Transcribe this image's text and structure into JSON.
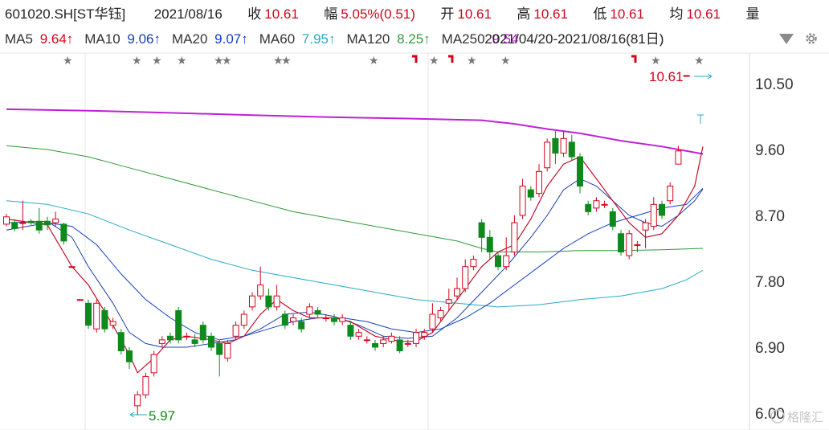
{
  "header": {
    "code": "601020.SH[ST华钰]",
    "date": "2021/08/16",
    "close_label": "收",
    "close": "10.61",
    "change_label": "幅",
    "change": "5.05%(0.51)",
    "open_label": "开",
    "open": "10.61",
    "high_label": "高",
    "high": "10.61",
    "low_label": "低",
    "low": "10.61",
    "avg_label": "均",
    "avg": "10.61",
    "vol_label": "量"
  },
  "ma_legend": [
    {
      "name": "MA5",
      "value": "9.64",
      "arrow": "↑",
      "color": "#d2041c"
    },
    {
      "name": "MA10",
      "value": "9.06",
      "arrow": "↑",
      "color": "#1c3fa8"
    },
    {
      "name": "MA20",
      "value": "9.07",
      "arrow": "↑",
      "color": "#1040c8"
    },
    {
      "name": "MA60",
      "value": "7.95",
      "arrow": "↑",
      "color": "#27aac6"
    },
    {
      "name": "MA120",
      "value": "8.25",
      "arrow": "↑",
      "color": "#2e9a3b"
    },
    {
      "name": "MA250",
      "value": "9.54",
      "arrow": "",
      "color": "#c020d8"
    }
  ],
  "range_text": "2021/04/20-2021/08/16(81日)",
  "icons": {
    "collapse": "triangle-down-icon",
    "settings": "gear-icon"
  },
  "colors": {
    "up": "#d2041c",
    "down": "#0e8a1c",
    "grid": "#e4e4e4",
    "axis_text": "#333333"
  },
  "watermark": "格隆汇",
  "chart_data": {
    "type": "candlestick",
    "ylim": [
      6.0,
      10.7
    ],
    "y_ticks": [
      "10.50",
      "9.60",
      "8.70",
      "7.80",
      "6.90",
      "6.00"
    ],
    "y_tick_values": [
      10.5,
      9.6,
      8.7,
      7.8,
      6.9,
      6.0
    ],
    "annotations": {
      "max_label": "10.61",
      "min_label": "5.97",
      "min_index": 15
    },
    "candles": [
      [
        8.58,
        8.68,
        8.55,
        8.72
      ],
      [
        8.6,
        8.52,
        8.48,
        8.65
      ],
      [
        8.6,
        8.6,
        8.5,
        8.9
      ],
      [
        8.62,
        8.6,
        8.57,
        8.65
      ],
      [
        8.62,
        8.5,
        8.45,
        8.8
      ],
      [
        8.62,
        8.57,
        8.5,
        8.68
      ],
      [
        8.6,
        8.65,
        8.55,
        8.75
      ],
      [
        8.58,
        8.35,
        8.3,
        8.6
      ],
      [
        8.0,
        8.0,
        8.0,
        8.0
      ],
      [
        7.55,
        7.55,
        7.55,
        7.55
      ],
      [
        7.5,
        7.2,
        7.15,
        7.55
      ],
      [
        7.15,
        7.5,
        7.1,
        7.55
      ],
      [
        7.4,
        7.15,
        7.1,
        7.45
      ],
      [
        7.2,
        7.25,
        7.15,
        7.3
      ],
      [
        7.1,
        6.85,
        6.8,
        7.15
      ],
      [
        6.85,
        6.7,
        6.6,
        6.9
      ],
      [
        6.1,
        6.25,
        5.97,
        6.3
      ],
      [
        6.25,
        6.5,
        6.2,
        6.55
      ],
      [
        6.55,
        6.8,
        6.5,
        6.85
      ],
      [
        6.95,
        7.0,
        6.9,
        7.05
      ],
      [
        7.05,
        7.0,
        6.95,
        7.1
      ],
      [
        7.4,
        7.0,
        6.95,
        7.45
      ],
      [
        7.05,
        7.05,
        7.0,
        7.1
      ],
      [
        7.0,
        6.95,
        6.9,
        7.08
      ],
      [
        7.2,
        7.0,
        6.95,
        7.25
      ],
      [
        7.05,
        6.9,
        6.85,
        7.1
      ],
      [
        6.95,
        6.8,
        6.5,
        7.0
      ],
      [
        6.75,
        6.95,
        6.7,
        7.0
      ],
      [
        7.05,
        7.2,
        7.0,
        7.25
      ],
      [
        7.2,
        7.35,
        7.15,
        7.4
      ],
      [
        7.45,
        7.6,
        7.4,
        7.65
      ],
      [
        7.6,
        7.75,
        7.55,
        8.0
      ],
      [
        7.6,
        7.45,
        7.4,
        7.7
      ],
      [
        7.45,
        7.6,
        7.4,
        7.75
      ],
      [
        7.35,
        7.2,
        7.15,
        7.4
      ],
      [
        7.25,
        7.3,
        7.2,
        7.35
      ],
      [
        7.25,
        7.15,
        7.1,
        7.3
      ],
      [
        7.35,
        7.45,
        7.3,
        7.5
      ],
      [
        7.4,
        7.35,
        7.3,
        7.45
      ],
      [
        7.3,
        7.3,
        7.25,
        7.35
      ],
      [
        7.3,
        7.25,
        7.2,
        7.35
      ],
      [
        7.25,
        7.3,
        7.2,
        7.35
      ],
      [
        7.2,
        7.05,
        7.0,
        7.25
      ],
      [
        7.05,
        7.1,
        7.0,
        7.15
      ],
      [
        7.0,
        7.0,
        6.95,
        7.05
      ],
      [
        6.95,
        6.9,
        6.85,
        7.0
      ],
      [
        6.95,
        7.0,
        6.9,
        7.05
      ],
      [
        6.98,
        7.05,
        6.95,
        7.1
      ],
      [
        7.0,
        6.85,
        6.82,
        7.05
      ],
      [
        6.95,
        6.95,
        6.9,
        7.0
      ],
      [
        6.95,
        7.1,
        6.9,
        7.15
      ],
      [
        7.05,
        7.1,
        7.0,
        7.15
      ],
      [
        7.15,
        7.35,
        7.1,
        7.5
      ],
      [
        7.3,
        7.4,
        7.25,
        7.45
      ],
      [
        7.5,
        7.55,
        7.4,
        7.7
      ],
      [
        7.6,
        7.7,
        7.55,
        7.85
      ],
      [
        7.7,
        8.0,
        7.65,
        8.1
      ],
      [
        8.0,
        8.1,
        7.95,
        8.15
      ],
      [
        8.6,
        8.4,
        8.2,
        8.65
      ],
      [
        8.4,
        8.2,
        8.1,
        8.5
      ],
      [
        8.15,
        8.0,
        7.95,
        8.2
      ],
      [
        8.0,
        8.15,
        7.95,
        8.4
      ],
      [
        8.2,
        8.6,
        8.15,
        8.7
      ],
      [
        8.7,
        9.1,
        8.65,
        9.2
      ],
      [
        9.05,
        8.95,
        8.9,
        9.1
      ],
      [
        9.0,
        9.3,
        8.95,
        9.4
      ],
      [
        9.35,
        9.7,
        9.3,
        9.75
      ],
      [
        9.75,
        9.55,
        9.4,
        9.85
      ],
      [
        9.55,
        9.75,
        9.5,
        9.85
      ],
      [
        9.7,
        9.5,
        9.45,
        9.8
      ],
      [
        9.5,
        9.1,
        9.0,
        9.55
      ],
      [
        8.85,
        8.75,
        8.7,
        8.9
      ],
      [
        8.8,
        8.9,
        8.75,
        8.95
      ],
      [
        8.85,
        8.85,
        8.8,
        8.9
      ],
      [
        8.75,
        8.55,
        8.5,
        8.8
      ],
      [
        8.45,
        8.2,
        8.15,
        8.5
      ],
      [
        8.15,
        8.45,
        8.1,
        8.5
      ],
      [
        8.3,
        8.3,
        8.2,
        8.35
      ],
      [
        8.5,
        8.6,
        8.25,
        8.65
      ],
      [
        8.55,
        8.85,
        8.5,
        8.95
      ],
      [
        8.85,
        8.7,
        8.65,
        8.9
      ],
      [
        8.9,
        9.1,
        8.85,
        9.15
      ],
      [
        9.4,
        9.58,
        9.4,
        9.65
      ],
      [
        10.61,
        10.61,
        10.61,
        10.61
      ]
    ],
    "ma5": [
      [
        0,
        8.65
      ],
      [
        5,
        8.57
      ],
      [
        8,
        8.0
      ],
      [
        10,
        7.75
      ],
      [
        13,
        7.2
      ],
      [
        15,
        6.8
      ],
      [
        16,
        6.55
      ],
      [
        18,
        6.75
      ],
      [
        20,
        7.0
      ],
      [
        22,
        7.05
      ],
      [
        25,
        7.0
      ],
      [
        27,
        6.95
      ],
      [
        29,
        7.05
      ],
      [
        31,
        7.35
      ],
      [
        33,
        7.55
      ],
      [
        35,
        7.4
      ],
      [
        37,
        7.3
      ],
      [
        40,
        7.3
      ],
      [
        42,
        7.25
      ],
      [
        45,
        7.05
      ],
      [
        48,
        6.98
      ],
      [
        50,
        6.98
      ],
      [
        52,
        7.1
      ],
      [
        54,
        7.4
      ],
      [
        56,
        7.7
      ],
      [
        58,
        8.0
      ],
      [
        60,
        8.2
      ],
      [
        62,
        8.3
      ],
      [
        64,
        8.65
      ],
      [
        66,
        9.1
      ],
      [
        68,
        9.4
      ],
      [
        70,
        9.5
      ],
      [
        72,
        9.2
      ],
      [
        74,
        8.9
      ],
      [
        76,
        8.6
      ],
      [
        78,
        8.4
      ],
      [
        80,
        8.45
      ],
      [
        82,
        8.7
      ],
      [
        84,
        9.1
      ],
      [
        85,
        9.64
      ]
    ],
    "ma10": [
      [
        0,
        8.6
      ],
      [
        5,
        8.62
      ],
      [
        8,
        8.4
      ],
      [
        10,
        8.0
      ],
      [
        13,
        7.5
      ],
      [
        15,
        7.1
      ],
      [
        17,
        6.95
      ],
      [
        19,
        6.9
      ],
      [
        22,
        6.9
      ],
      [
        25,
        6.95
      ],
      [
        28,
        7.0
      ],
      [
        31,
        7.15
      ],
      [
        34,
        7.35
      ],
      [
        37,
        7.38
      ],
      [
        40,
        7.32
      ],
      [
        43,
        7.2
      ],
      [
        46,
        7.05
      ],
      [
        49,
        7.02
      ],
      [
        52,
        7.05
      ],
      [
        55,
        7.3
      ],
      [
        58,
        7.65
      ],
      [
        61,
        8.0
      ],
      [
        64,
        8.4
      ],
      [
        66,
        8.7
      ],
      [
        68,
        9.05
      ],
      [
        70,
        9.2
      ],
      [
        72,
        9.1
      ],
      [
        74,
        8.9
      ],
      [
        76,
        8.7
      ],
      [
        78,
        8.6
      ],
      [
        80,
        8.55
      ],
      [
        82,
        8.7
      ],
      [
        84,
        8.9
      ],
      [
        85,
        9.06
      ]
    ],
    "ma20": [
      [
        0,
        8.5
      ],
      [
        5,
        8.6
      ],
      [
        8,
        8.55
      ],
      [
        11,
        8.3
      ],
      [
        14,
        7.9
      ],
      [
        17,
        7.55
      ],
      [
        20,
        7.3
      ],
      [
        23,
        7.1
      ],
      [
        26,
        7.0
      ],
      [
        29,
        7.05
      ],
      [
        32,
        7.15
      ],
      [
        35,
        7.25
      ],
      [
        38,
        7.3
      ],
      [
        41,
        7.3
      ],
      [
        44,
        7.25
      ],
      [
        47,
        7.15
      ],
      [
        50,
        7.1
      ],
      [
        53,
        7.15
      ],
      [
        56,
        7.3
      ],
      [
        59,
        7.5
      ],
      [
        62,
        7.75
      ],
      [
        65,
        8.0
      ],
      [
        68,
        8.25
      ],
      [
        71,
        8.45
      ],
      [
        74,
        8.6
      ],
      [
        77,
        8.7
      ],
      [
        80,
        8.8
      ],
      [
        83,
        8.85
      ],
      [
        85,
        9.07
      ]
    ],
    "ma60": [
      [
        0,
        8.9
      ],
      [
        5,
        8.85
      ],
      [
        10,
        8.72
      ],
      [
        15,
        8.5
      ],
      [
        20,
        8.3
      ],
      [
        25,
        8.1
      ],
      [
        30,
        7.95
      ],
      [
        35,
        7.85
      ],
      [
        40,
        7.75
      ],
      [
        45,
        7.65
      ],
      [
        50,
        7.55
      ],
      [
        55,
        7.5
      ],
      [
        60,
        7.45
      ],
      [
        65,
        7.48
      ],
      [
        70,
        7.55
      ],
      [
        75,
        7.6
      ],
      [
        80,
        7.7
      ],
      [
        83,
        7.82
      ],
      [
        85,
        7.95
      ]
    ],
    "ma120": [
      [
        0,
        9.65
      ],
      [
        5,
        9.6
      ],
      [
        10,
        9.5
      ],
      [
        15,
        9.35
      ],
      [
        20,
        9.2
      ],
      [
        25,
        9.05
      ],
      [
        30,
        8.9
      ],
      [
        35,
        8.75
      ],
      [
        40,
        8.65
      ],
      [
        45,
        8.55
      ],
      [
        50,
        8.45
      ],
      [
        55,
        8.35
      ],
      [
        58,
        8.25
      ],
      [
        60,
        8.2
      ],
      [
        65,
        8.2
      ],
      [
        70,
        8.22
      ],
      [
        75,
        8.22
      ],
      [
        80,
        8.23
      ],
      [
        85,
        8.25
      ]
    ],
    "ma250": [
      [
        0,
        10.15
      ],
      [
        10,
        10.13
      ],
      [
        20,
        10.1
      ],
      [
        30,
        10.07
      ],
      [
        40,
        10.04
      ],
      [
        50,
        10.02
      ],
      [
        58,
        10.0
      ],
      [
        62,
        9.95
      ],
      [
        66,
        9.88
      ],
      [
        70,
        9.82
      ],
      [
        75,
        9.72
      ],
      [
        80,
        9.64
      ],
      [
        85,
        9.54
      ]
    ]
  }
}
